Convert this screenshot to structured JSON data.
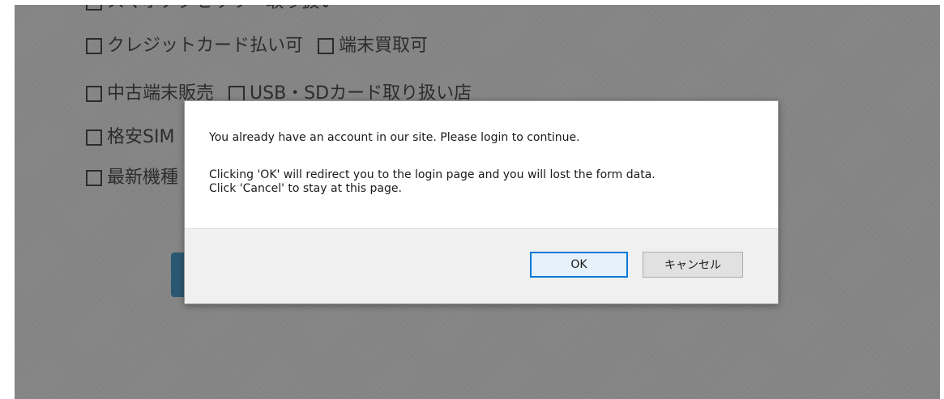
{
  "background_options": [
    {
      "label": "スマホアクセサリー取り扱い"
    },
    {
      "label": "クレジットカード払い可",
      "label2": "端末買取可"
    },
    {
      "label": "中古端末販売",
      "label2": "USB・SDカード取り扱い店"
    },
    {
      "label": "格安SIM"
    },
    {
      "label": "最新機種"
    }
  ],
  "dialog": {
    "message_line1": "You already have an account in our site. Please login to continue.",
    "message_line2": "Clicking 'OK' will redirect you to the login page and you will lost the form data.",
    "message_line3": "Click 'Cancel' to stay at this page.",
    "ok_label": "OK",
    "cancel_label": "キャンセル"
  },
  "colors": {
    "overlay": "#858585",
    "ok_border": "#0078d7",
    "background_button": "#2b5871"
  }
}
